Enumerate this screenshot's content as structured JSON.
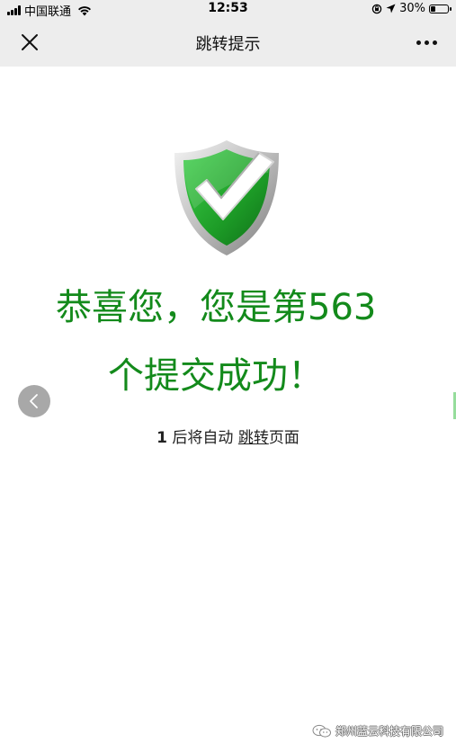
{
  "status_bar": {
    "carrier": "中国联通",
    "time": "12:53",
    "battery_percent_label": "30%",
    "battery_level": 0.3
  },
  "nav": {
    "title": "跳转提示"
  },
  "main": {
    "headline_line1": "恭喜您，您是第563",
    "headline_line2": "个提交成功！",
    "countdown": "1",
    "redirect_prefix": " 后将自动 ",
    "jump_link": "跳转",
    "redirect_suffix": "页面"
  },
  "watermark": {
    "text": "郑州蓝云科技有限公司"
  },
  "colors": {
    "headline_green": "#138a1b",
    "bar_gray": "#ededed",
    "shield_green": "#1fa22a"
  },
  "icons": {
    "close": "close-icon",
    "more": "more-dots-icon",
    "back": "chevron-left-icon",
    "shield": "shield-check-icon"
  }
}
